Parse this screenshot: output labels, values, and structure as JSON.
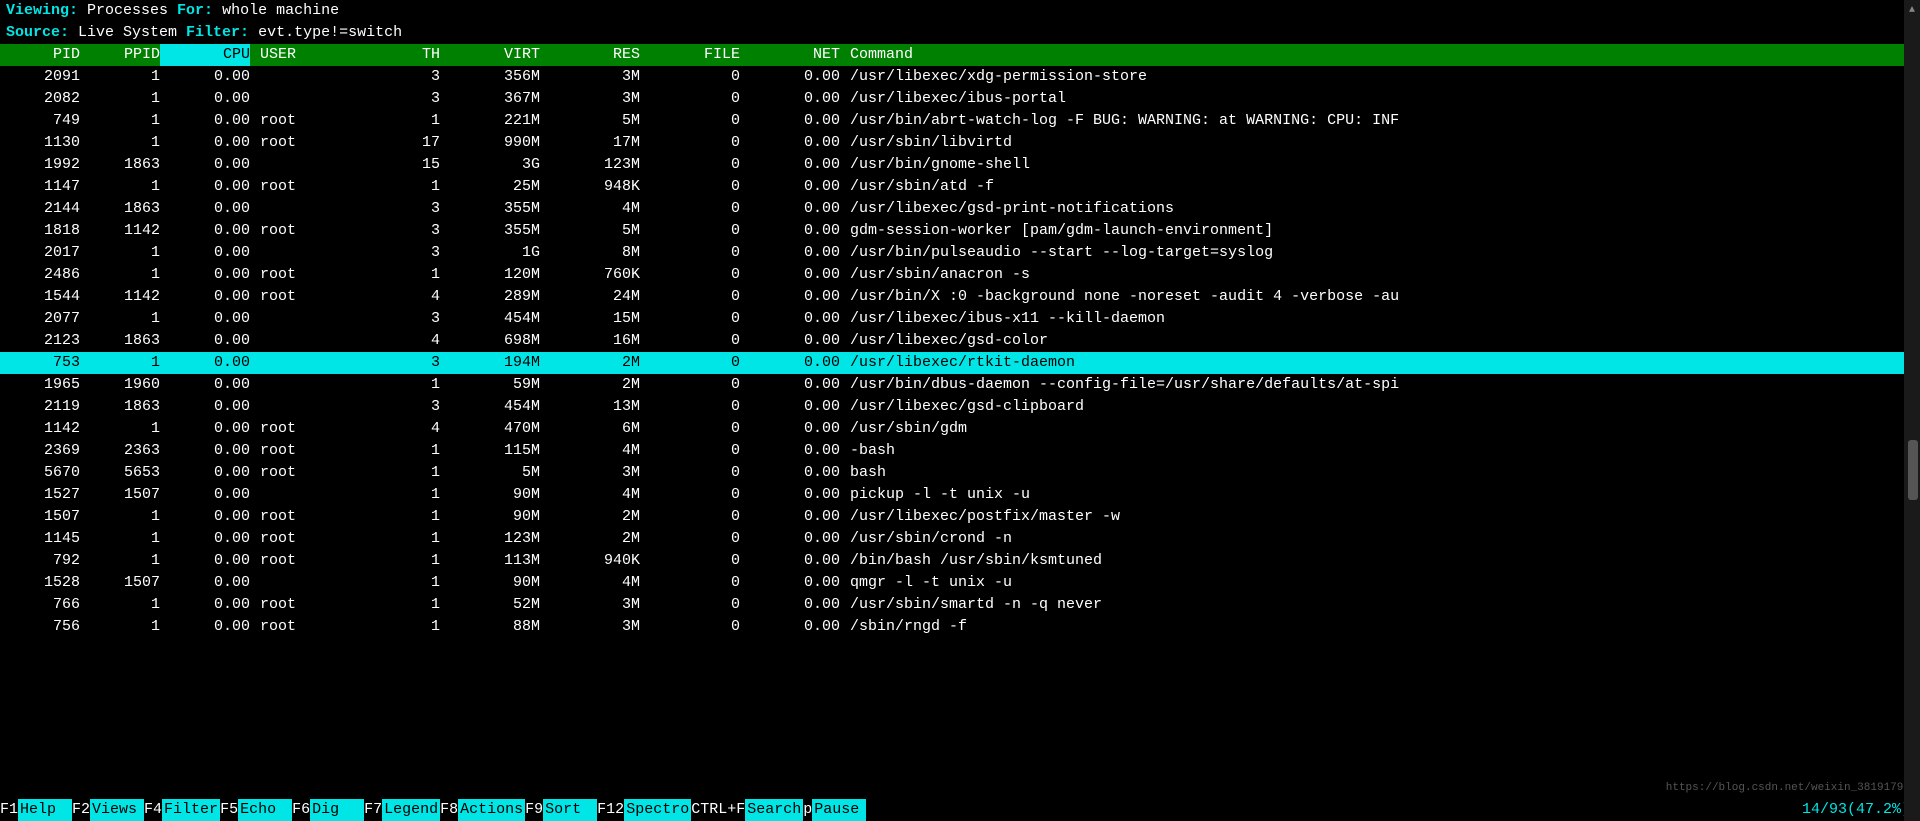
{
  "header": {
    "viewing_label": "Viewing:",
    "viewing_value": " Processes ",
    "for_label": "For:",
    "for_value": " whole machine",
    "source_label": "Source:",
    "source_value": " Live System ",
    "filter_label": "Filter:",
    "filter_value": " evt.type!=switch"
  },
  "columns": {
    "pid": "PID",
    "ppid": "PPID",
    "cpu": "CPU",
    "user": "USER",
    "th": "TH",
    "virt": "VIRT",
    "res": "RES",
    "file": "FILE",
    "net": "NET",
    "cmd": "Command"
  },
  "selected_column": "cpu",
  "highlighted_pid": 753,
  "rows": [
    {
      "pid": "2091",
      "ppid": "1",
      "cpu": "0.00",
      "user": "",
      "th": "3",
      "virt": "356M",
      "res": "3M",
      "file": "0",
      "net": "0.00",
      "cmd": "/usr/libexec/xdg-permission-store"
    },
    {
      "pid": "2082",
      "ppid": "1",
      "cpu": "0.00",
      "user": "",
      "th": "3",
      "virt": "367M",
      "res": "3M",
      "file": "0",
      "net": "0.00",
      "cmd": "/usr/libexec/ibus-portal"
    },
    {
      "pid": "749",
      "ppid": "1",
      "cpu": "0.00",
      "user": "root",
      "th": "1",
      "virt": "221M",
      "res": "5M",
      "file": "0",
      "net": "0.00",
      "cmd": "/usr/bin/abrt-watch-log -F BUG: WARNING: at WARNING: CPU: INF"
    },
    {
      "pid": "1130",
      "ppid": "1",
      "cpu": "0.00",
      "user": "root",
      "th": "17",
      "virt": "990M",
      "res": "17M",
      "file": "0",
      "net": "0.00",
      "cmd": "/usr/sbin/libvirtd"
    },
    {
      "pid": "1992",
      "ppid": "1863",
      "cpu": "0.00",
      "user": "",
      "th": "15",
      "virt": "3G",
      "res": "123M",
      "file": "0",
      "net": "0.00",
      "cmd": "/usr/bin/gnome-shell"
    },
    {
      "pid": "1147",
      "ppid": "1",
      "cpu": "0.00",
      "user": "root",
      "th": "1",
      "virt": "25M",
      "res": "948K",
      "file": "0",
      "net": "0.00",
      "cmd": "/usr/sbin/atd -f"
    },
    {
      "pid": "2144",
      "ppid": "1863",
      "cpu": "0.00",
      "user": "",
      "th": "3",
      "virt": "355M",
      "res": "4M",
      "file": "0",
      "net": "0.00",
      "cmd": "/usr/libexec/gsd-print-notifications"
    },
    {
      "pid": "1818",
      "ppid": "1142",
      "cpu": "0.00",
      "user": "root",
      "th": "3",
      "virt": "355M",
      "res": "5M",
      "file": "0",
      "net": "0.00",
      "cmd": "gdm-session-worker [pam/gdm-launch-environment]"
    },
    {
      "pid": "2017",
      "ppid": "1",
      "cpu": "0.00",
      "user": "",
      "th": "3",
      "virt": "1G",
      "res": "8M",
      "file": "0",
      "net": "0.00",
      "cmd": "/usr/bin/pulseaudio --start --log-target=syslog"
    },
    {
      "pid": "2486",
      "ppid": "1",
      "cpu": "0.00",
      "user": "root",
      "th": "1",
      "virt": "120M",
      "res": "760K",
      "file": "0",
      "net": "0.00",
      "cmd": "/usr/sbin/anacron -s"
    },
    {
      "pid": "1544",
      "ppid": "1142",
      "cpu": "0.00",
      "user": "root",
      "th": "4",
      "virt": "289M",
      "res": "24M",
      "file": "0",
      "net": "0.00",
      "cmd": "/usr/bin/X :0 -background none -noreset -audit 4 -verbose -au"
    },
    {
      "pid": "2077",
      "ppid": "1",
      "cpu": "0.00",
      "user": "",
      "th": "3",
      "virt": "454M",
      "res": "15M",
      "file": "0",
      "net": "0.00",
      "cmd": "/usr/libexec/ibus-x11 --kill-daemon"
    },
    {
      "pid": "2123",
      "ppid": "1863",
      "cpu": "0.00",
      "user": "",
      "th": "4",
      "virt": "698M",
      "res": "16M",
      "file": "0",
      "net": "0.00",
      "cmd": "/usr/libexec/gsd-color"
    },
    {
      "pid": "753",
      "ppid": "1",
      "cpu": "0.00",
      "user": "",
      "th": "3",
      "virt": "194M",
      "res": "2M",
      "file": "0",
      "net": "0.00",
      "cmd": "/usr/libexec/rtkit-daemon"
    },
    {
      "pid": "1965",
      "ppid": "1960",
      "cpu": "0.00",
      "user": "",
      "th": "1",
      "virt": "59M",
      "res": "2M",
      "file": "0",
      "net": "0.00",
      "cmd": "/usr/bin/dbus-daemon --config-file=/usr/share/defaults/at-spi"
    },
    {
      "pid": "2119",
      "ppid": "1863",
      "cpu": "0.00",
      "user": "",
      "th": "3",
      "virt": "454M",
      "res": "13M",
      "file": "0",
      "net": "0.00",
      "cmd": "/usr/libexec/gsd-clipboard"
    },
    {
      "pid": "1142",
      "ppid": "1",
      "cpu": "0.00",
      "user": "root",
      "th": "4",
      "virt": "470M",
      "res": "6M",
      "file": "0",
      "net": "0.00",
      "cmd": "/usr/sbin/gdm"
    },
    {
      "pid": "2369",
      "ppid": "2363",
      "cpu": "0.00",
      "user": "root",
      "th": "1",
      "virt": "115M",
      "res": "4M",
      "file": "0",
      "net": "0.00",
      "cmd": "-bash"
    },
    {
      "pid": "5670",
      "ppid": "5653",
      "cpu": "0.00",
      "user": "root",
      "th": "1",
      "virt": "5M",
      "res": "3M",
      "file": "0",
      "net": "0.00",
      "cmd": "bash"
    },
    {
      "pid": "1527",
      "ppid": "1507",
      "cpu": "0.00",
      "user": "",
      "th": "1",
      "virt": "90M",
      "res": "4M",
      "file": "0",
      "net": "0.00",
      "cmd": "pickup -l -t unix -u"
    },
    {
      "pid": "1507",
      "ppid": "1",
      "cpu": "0.00",
      "user": "root",
      "th": "1",
      "virt": "90M",
      "res": "2M",
      "file": "0",
      "net": "0.00",
      "cmd": "/usr/libexec/postfix/master -w"
    },
    {
      "pid": "1145",
      "ppid": "1",
      "cpu": "0.00",
      "user": "root",
      "th": "1",
      "virt": "123M",
      "res": "2M",
      "file": "0",
      "net": "0.00",
      "cmd": "/usr/sbin/crond -n"
    },
    {
      "pid": "792",
      "ppid": "1",
      "cpu": "0.00",
      "user": "root",
      "th": "1",
      "virt": "113M",
      "res": "940K",
      "file": "0",
      "net": "0.00",
      "cmd": "/bin/bash /usr/sbin/ksmtuned"
    },
    {
      "pid": "1528",
      "ppid": "1507",
      "cpu": "0.00",
      "user": "",
      "th": "1",
      "virt": "90M",
      "res": "4M",
      "file": "0",
      "net": "0.00",
      "cmd": "qmgr -l -t unix -u"
    },
    {
      "pid": "766",
      "ppid": "1",
      "cpu": "0.00",
      "user": "root",
      "th": "1",
      "virt": "52M",
      "res": "3M",
      "file": "0",
      "net": "0.00",
      "cmd": "/usr/sbin/smartd -n -q never"
    },
    {
      "pid": "756",
      "ppid": "1",
      "cpu": "0.00",
      "user": "root",
      "th": "1",
      "virt": "88M",
      "res": "3M",
      "file": "0",
      "net": "0.00",
      "cmd": "/sbin/rngd -f"
    }
  ],
  "fkeys": [
    {
      "key": "F1",
      "label": "Help  "
    },
    {
      "key": "F2",
      "label": "Views "
    },
    {
      "key": "F4",
      "label": "Filter"
    },
    {
      "key": "F5",
      "label": "Echo  "
    },
    {
      "key": "F6",
      "label": "Dig   "
    },
    {
      "key": "F7",
      "label": "Legend"
    },
    {
      "key": "F8",
      "label": "Actions"
    },
    {
      "key": "F9",
      "label": "Sort  "
    },
    {
      "key": "F12",
      "label": "Spectro"
    },
    {
      "key": "CTRL+F",
      "label": "Search"
    },
    {
      "key": "p ",
      "label": "Pause "
    }
  ],
  "clock": "14/93(47.2%)",
  "watermark": "https://blog.csdn.net/weixin_38191793"
}
